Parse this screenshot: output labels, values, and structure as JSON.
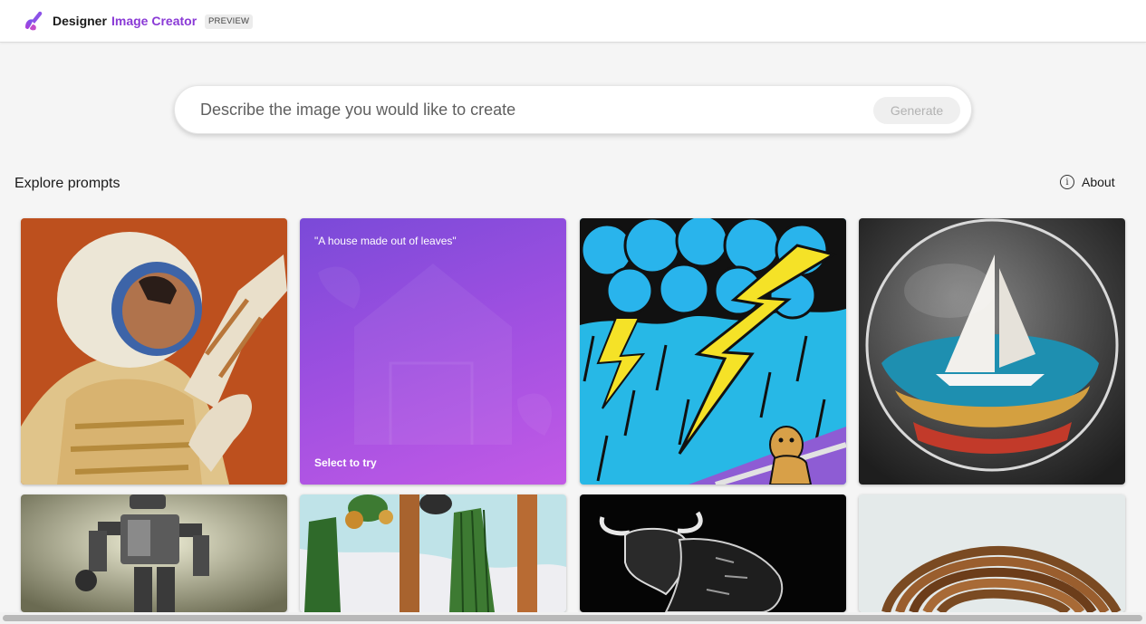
{
  "header": {
    "brand": "Designer",
    "product": "Image Creator",
    "badge": "PREVIEW"
  },
  "search": {
    "placeholder": "Describe the image you would like to create",
    "generate_label": "Generate"
  },
  "explore": {
    "title": "Explore prompts",
    "about_label": "About"
  },
  "cards": [
    {
      "kind": "image",
      "subject": "astronaut painting"
    },
    {
      "kind": "prompt",
      "prompt": "\"A house made out of leaves\"",
      "cta": "Select to try"
    },
    {
      "kind": "image",
      "subject": "comic lightning storm with dog"
    },
    {
      "kind": "image",
      "subject": "sailboat in glass sphere"
    },
    {
      "kind": "image",
      "subject": "retro robot photo"
    },
    {
      "kind": "image",
      "subject": "cactus painting"
    },
    {
      "kind": "image",
      "subject": "bull line art"
    },
    {
      "kind": "image",
      "subject": "wooden spiral sculpture"
    }
  ],
  "colors": {
    "brand_purple": "#8a3ad6",
    "background": "#f5f5f5"
  }
}
